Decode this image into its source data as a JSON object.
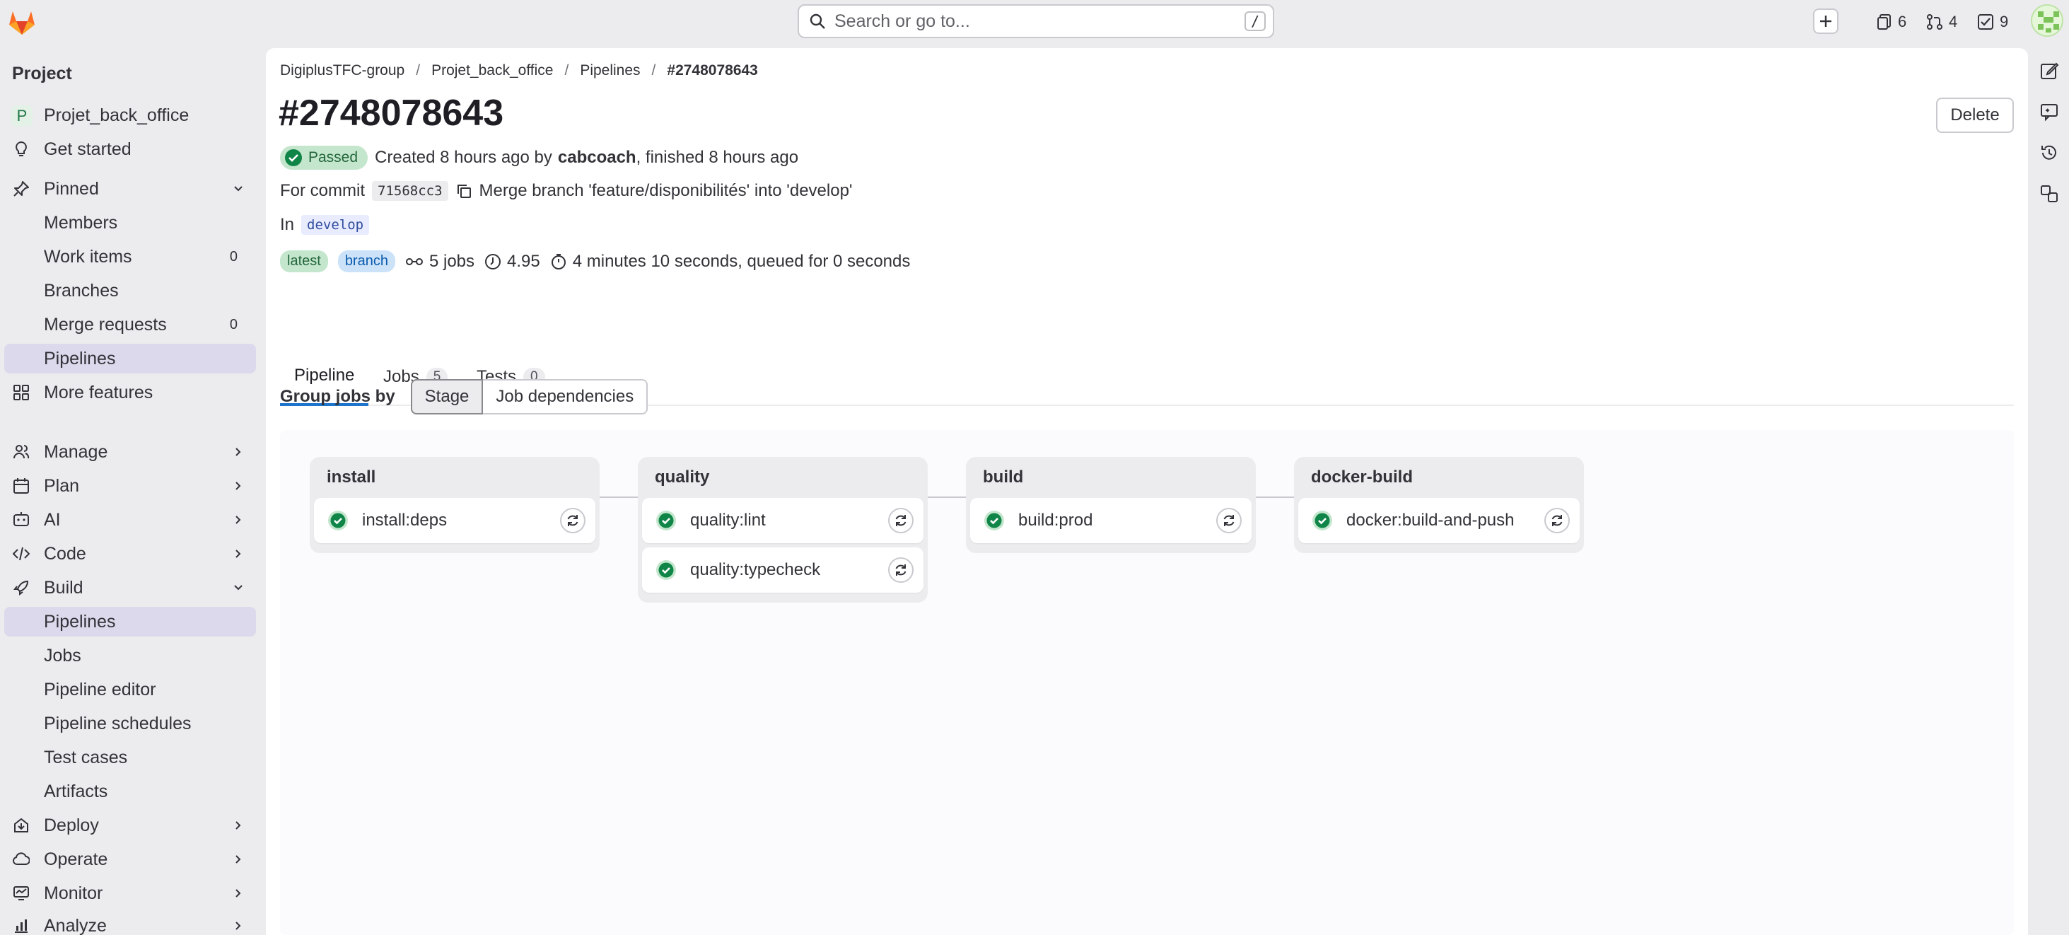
{
  "topbar": {
    "search_placeholder": "Search or go to...",
    "search_shortcut": "/",
    "issues_count": "6",
    "merge_requests_count": "4",
    "todos_count": "9"
  },
  "sidebar": {
    "heading": "Project",
    "project_name": "Projet_back_office",
    "project_initial": "P",
    "get_started": "Get started",
    "pinned": "Pinned",
    "pinned_items": [
      {
        "label": "Members",
        "count": ""
      },
      {
        "label": "Work items",
        "count": "0"
      },
      {
        "label": "Branches",
        "count": ""
      },
      {
        "label": "Merge requests",
        "count": "0"
      },
      {
        "label": "Pipelines",
        "count": ""
      }
    ],
    "more_features": "More features",
    "sections": [
      {
        "label": "Manage"
      },
      {
        "label": "Plan"
      },
      {
        "label": "AI"
      },
      {
        "label": "Code"
      },
      {
        "label": "Build"
      }
    ],
    "build_items": [
      {
        "label": "Pipelines"
      },
      {
        "label": "Jobs"
      },
      {
        "label": "Pipeline editor"
      },
      {
        "label": "Pipeline schedules"
      },
      {
        "label": "Test cases"
      },
      {
        "label": "Artifacts"
      }
    ],
    "bottom_sections": [
      {
        "label": "Deploy"
      },
      {
        "label": "Operate"
      },
      {
        "label": "Monitor"
      },
      {
        "label": "Analyze"
      }
    ]
  },
  "breadcrumb": [
    "DigiplusTFC-group",
    "Projet_back_office",
    "Pipelines",
    "#2748078643"
  ],
  "pipeline": {
    "title": "#2748078643",
    "delete_label": "Delete",
    "status": "Passed",
    "created_prefix": "Created 8 hours ago by",
    "author": "cabcoach",
    "finished_suffix": ", finished 8 hours ago",
    "commit_prefix": "For commit",
    "commit_sha": "71568cc3",
    "commit_message": "Merge branch 'feature/disponibilités' into 'develop'",
    "in_label": "In",
    "branch": "develop",
    "badge_latest": "latest",
    "badge_branch": "branch",
    "jobs_count_text": "5 jobs",
    "compute_value": "4.95",
    "duration_text": "4 minutes 10 seconds, queued for 0 seconds"
  },
  "tabs": [
    {
      "label": "Pipeline",
      "count": ""
    },
    {
      "label": "Jobs",
      "count": "5"
    },
    {
      "label": "Tests",
      "count": "0"
    }
  ],
  "group_jobs": {
    "label": "Group jobs by",
    "stage": "Stage",
    "dependencies": "Job dependencies"
  },
  "stages": [
    {
      "name": "install",
      "jobs": [
        "install:deps"
      ]
    },
    {
      "name": "quality",
      "jobs": [
        "quality:lint",
        "quality:typecheck"
      ]
    },
    {
      "name": "build",
      "jobs": [
        "build:prod"
      ]
    },
    {
      "name": "docker-build",
      "jobs": [
        "docker:build-and-push"
      ]
    }
  ],
  "colors": {
    "success": "#108548",
    "active_nav": "#dcd9ec",
    "tab_underline": "#1f75cb"
  }
}
